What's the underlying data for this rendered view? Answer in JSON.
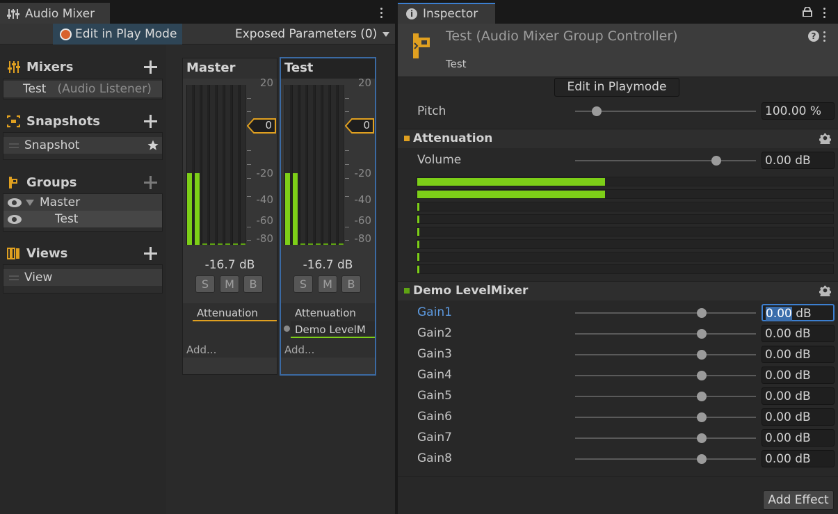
{
  "mixer_window": {
    "tab_title": "Audio Mixer",
    "edit_in_play_mode": "Edit in Play Mode",
    "exposed_parameters": "Exposed Parameters (0)",
    "sections": {
      "mixers": {
        "title": "Mixers",
        "items": [
          {
            "name": "Test",
            "detail": "(Audio Listener)"
          }
        ]
      },
      "snapshots": {
        "title": "Snapshots",
        "items": [
          {
            "name": "Snapshot"
          }
        ]
      },
      "groups": {
        "title": "Groups",
        "items": [
          {
            "name": "Master"
          },
          {
            "name": "Test"
          }
        ]
      },
      "views": {
        "title": "Views",
        "items": [
          {
            "name": "View"
          }
        ]
      }
    },
    "scale_labels": [
      "20",
      "0",
      "-20",
      "-40",
      "-60",
      "-80"
    ],
    "strips": [
      {
        "name": "Master",
        "fader_value": "0",
        "db_readout": "-16.7 dB",
        "solo": "S",
        "mute": "M",
        "bypass": "B",
        "effects": [
          "Attenuation"
        ],
        "add_label": "Add...",
        "meter_levels": [
          0.45,
          0.45
        ]
      },
      {
        "name": "Test",
        "fader_value": "0",
        "db_readout": "-16.7 dB",
        "solo": "S",
        "mute": "M",
        "bypass": "B",
        "effects": [
          "Attenuation",
          "Demo LevelM"
        ],
        "add_label": "Add...",
        "meter_levels": [
          0.45,
          0.45
        ]
      }
    ]
  },
  "inspector": {
    "tab_title": "Inspector",
    "header_title": "Test (Audio Mixer Group Controller)",
    "header_subtitle": "Test",
    "edit_in_playmode": "Edit in Playmode",
    "pitch": {
      "label": "Pitch",
      "value": "100.00 %",
      "level": 0.12
    },
    "attenuation": {
      "title": "Attenuation",
      "volume": {
        "label": "Volume",
        "value": "0.00 dB",
        "level": 0.78
      },
      "vu_levels": [
        0.45,
        0.45,
        0,
        0,
        0,
        0,
        0,
        0
      ]
    },
    "level_mixer": {
      "title": "Demo LevelMixer",
      "gains": [
        {
          "label": "Gain1",
          "value_num": "0.00",
          "unit": "dB",
          "level": 0.7
        },
        {
          "label": "Gain2",
          "value": "0.00 dB",
          "level": 0.7
        },
        {
          "label": "Gain3",
          "value": "0.00 dB",
          "level": 0.7
        },
        {
          "label": "Gain4",
          "value": "0.00 dB",
          "level": 0.7
        },
        {
          "label": "Gain5",
          "value": "0.00 dB",
          "level": 0.7
        },
        {
          "label": "Gain6",
          "value": "0.00 dB",
          "level": 0.7
        },
        {
          "label": "Gain7",
          "value": "0.00 dB",
          "level": 0.7
        },
        {
          "label": "Gain8",
          "value": "0.00 dB",
          "level": 0.7
        }
      ]
    },
    "add_effect": "Add Effect"
  },
  "colors": {
    "meter_green": "#7dcf18",
    "accent_orange": "#e0a020",
    "selection_blue": "#3c7fd0",
    "record_red": "#d8622d"
  }
}
